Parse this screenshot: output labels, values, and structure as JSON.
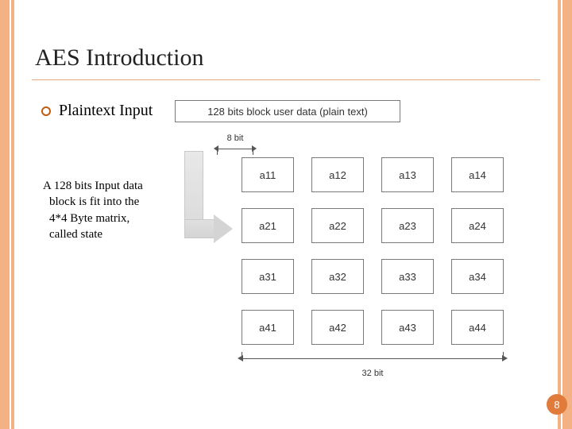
{
  "title": "AES Introduction",
  "bullet": {
    "label": "Plaintext Input"
  },
  "caption": "128 bits block user data (plain text)",
  "byte_width_label": "8 bit",
  "row_width_label": "32 bit",
  "paragraph": {
    "line1": "A 128 bits Input data",
    "line2": "block is fit into the",
    "line3": "4*4 Byte matrix,",
    "line4": "called state"
  },
  "matrix": [
    [
      "a11",
      "a12",
      "a13",
      "a14"
    ],
    [
      "a21",
      "a22",
      "a23",
      "a24"
    ],
    [
      "a31",
      "a32",
      "a33",
      "a34"
    ],
    [
      "a41",
      "a42",
      "a43",
      "a44"
    ]
  ],
  "page_number": "8"
}
